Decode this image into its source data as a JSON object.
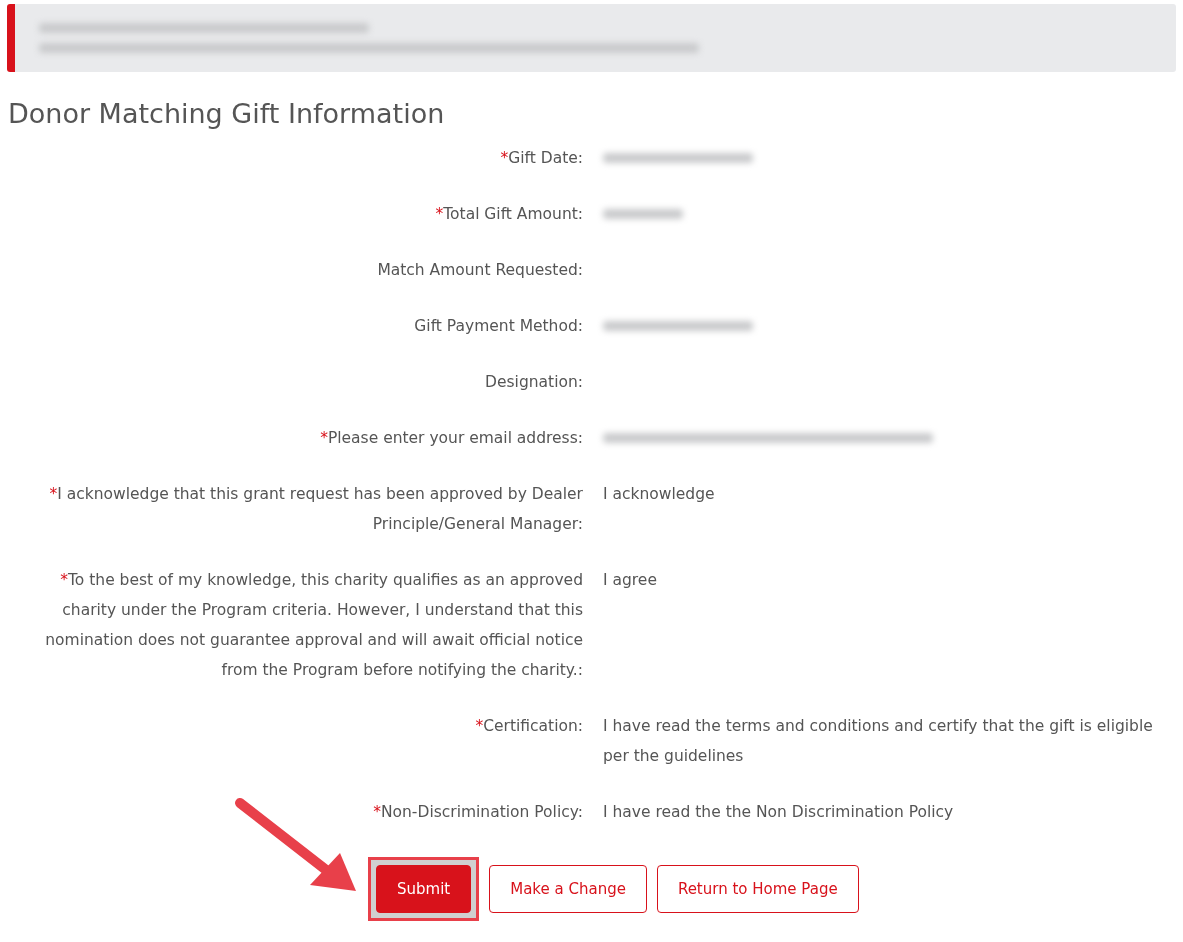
{
  "header": {
    "lines": [
      {
        "kind": "redacted"
      },
      {
        "kind": "redacted"
      }
    ]
  },
  "title": "Donor Matching Gift Information",
  "fields": [
    {
      "marker": "*",
      "label": "Gift Date:",
      "value": {
        "kind": "redacted"
      }
    },
    {
      "marker": "*",
      "label": "Total Gift Amount:",
      "value": {
        "kind": "redacted"
      }
    },
    {
      "label": "Match Amount Requested:"
    },
    {
      "label": "Gift Payment Method:",
      "value": {
        "kind": "redacted"
      }
    },
    {
      "label": "Designation:"
    },
    {
      "marker": "*",
      "label": "Please enter your email address:",
      "value": {
        "kind": "redacted"
      }
    },
    {
      "marker": "*",
      "label": "I acknowledge that this grant request has been approved by Dealer Principle/General Manager:",
      "value": {
        "kind": "text",
        "text": "I acknowledge"
      }
    },
    {
      "marker": "*",
      "label": "To the best of my knowledge, this charity qualifies as an approved charity under the Program criteria. However, I understand that this nomination does not guarantee approval and will await official notice from the Program before notifying the charity.:",
      "value": {
        "kind": "text",
        "text": "I agree"
      }
    },
    {
      "marker": "*",
      "label": "Certification:",
      "value": {
        "kind": "text",
        "text": "I have read the terms and conditions and certify that the gift is eligible per the guidelines"
      }
    },
    {
      "marker": "*",
      "label": "Non-Discrimination Policy:",
      "value": {
        "kind": "text",
        "text": "I have read the the Non Discrimination Policy"
      }
    }
  ],
  "buttons": [
    {
      "kind": "primary",
      "label": "Submit",
      "highlighted": true
    },
    {
      "kind": "outline",
      "label": "Make a Change",
      "highlighted": false
    },
    {
      "kind": "outline",
      "label": "Return to Home Page",
      "highlighted": false
    }
  ]
}
